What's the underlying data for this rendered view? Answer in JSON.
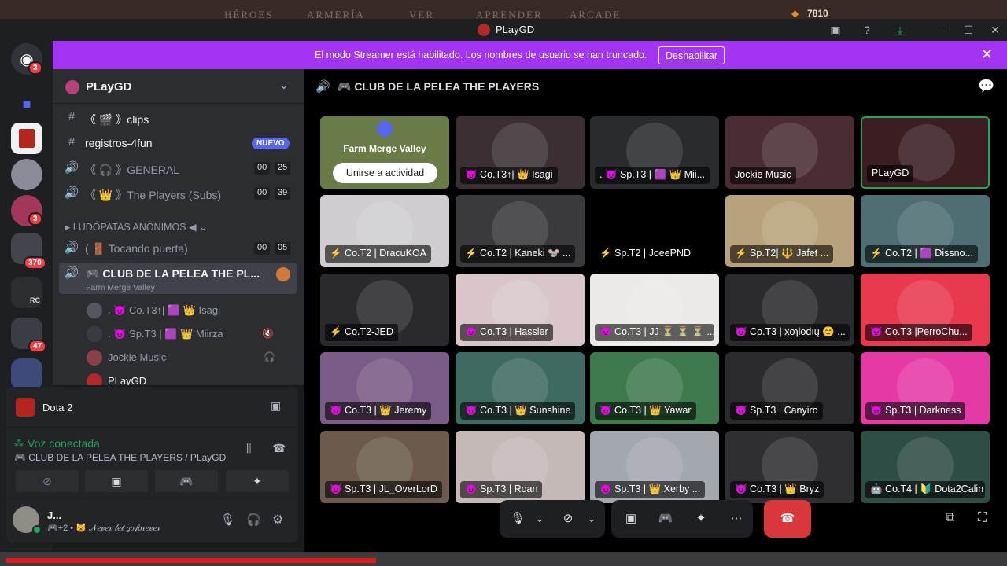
{
  "game_bar": {
    "tabs": [
      "HÉROES",
      "ARMERÍA",
      "VER",
      "APRENDER",
      "ARCADE"
    ],
    "shards": "7810"
  },
  "window": {
    "title": "PLayGD"
  },
  "banner": {
    "message": "El modo Streamer está habilitado. Los nombres de usuario se han truncado.",
    "button": "Deshabilitar"
  },
  "rail": {
    "badges": [
      "3",
      "3",
      "370",
      "47"
    ],
    "rc_label": "RC"
  },
  "server": {
    "name": "PLayGD"
  },
  "channels": [
    {
      "label": "《 🎬 》clips",
      "type": "text"
    },
    {
      "label": "registros-4fun",
      "type": "text",
      "badge": "NUEVO"
    },
    {
      "label": "《 🎧 》GENERAL",
      "type": "voice",
      "count_a": "00",
      "count_b": "25"
    },
    {
      "label": "《 👑 》The Players (Subs)",
      "type": "voice",
      "count_a": "00",
      "count_b": "39"
    }
  ],
  "category": {
    "label": "LUDÓPATAS ANÓNIMOS ◀"
  },
  "channels2": [
    {
      "label": "( 🚪 Tocando puerta)",
      "count_a": "00",
      "count_b": "05"
    },
    {
      "label": "🎮 CLUB DE LA PELEA THE PL...",
      "sub": "Farm Merge Valley"
    }
  ],
  "voice_users": [
    {
      "label": ". 😈 Co.T3↑| 🟪 👑 Isagi"
    },
    {
      "label": ". 😈 Sp.T3 | 🟪 👑 Miirza"
    },
    {
      "label": "Jockie Music"
    },
    {
      "label": "PLayGD"
    }
  ],
  "activity": {
    "name": "Dota 2"
  },
  "voice_status": {
    "title": "Voz conectada",
    "channel": "🎮 CLUB DE LA PELEA THE PLAYERS / PLayGD"
  },
  "user_panel": {
    "name": "J...",
    "status": "🎮+2 • 🐱 𝒩𝑒𝓋𝑒𝓇 𝓁𝑒𝓉 𝑔𝑜𝒻𝑜𝓇𝑒𝓋𝑒𝓇"
  },
  "stage": {
    "title": "🎮 CLUB DE LA PELEA THE PLAYERS"
  },
  "activity_tile": {
    "title": "Farm Merge Valley",
    "button": "Unirse a actividad"
  },
  "tiles": [
    {
      "label": "😈 Co.T3↑| 👑 Isagi",
      "bg": "#3a3033"
    },
    {
      "label": ". 😈 Sp.T3 | 🟪 👑 Mii...",
      "bg": "#2a2b2e"
    },
    {
      "label": "Jockie Music",
      "bg": "#4a2c33"
    },
    {
      "label": "PLayGD",
      "bg": "#3b1d22"
    },
    {
      "label": "⚡ Co.T2 | DracuKOA",
      "bg": "#cfcdd0"
    },
    {
      "label": "⚡ Co.T2 | Kaneki 🐭 ...",
      "bg": "#3a3a3d"
    },
    {
      "label": "⚡ Sp.T2 | JoeePND",
      "bg": "#000000"
    },
    {
      "label": "⚡ Sp.T2| 🔱 Jafet ...",
      "bg": "#b8a27a"
    },
    {
      "label": "⚡ Co.T2 | 🟪 Dissno...",
      "bg": "#4d6f73"
    },
    {
      "label": "⚡ Co.T2-JED",
      "bg": "#2a2a2d"
    },
    {
      "label": "😈 Co.T3 | Hassler",
      "bg": "#d8c6c8"
    },
    {
      "label": "😈 Co.T3 | JJ ⏳ ⏳ ⏳ ...",
      "bg": "#eceae6"
    },
    {
      "label": "😈 Co.T3 | xoɿlodıų 😊 ...",
      "bg": "#2b2b2e"
    },
    {
      "label": "😈 Co.T3 |PerroChu...",
      "bg": "#e8394f"
    },
    {
      "label": "😈 Co.T3 | 👑 Jeremy",
      "bg": "#7a5a86"
    },
    {
      "label": "😈 Co.T3 | 👑 Sunshine",
      "bg": "#3f6a62"
    },
    {
      "label": "😈 Co.T3 | 👑 Yawar",
      "bg": "#3f7a4f"
    },
    {
      "label": "😈 Sp.T3 | Canyiro",
      "bg": "#2b2b2e"
    },
    {
      "label": "😈 Sp.T3 | Darkness",
      "bg": "#e53aa6"
    },
    {
      "label": "😈 Sp.T3 | JL_OverLorD",
      "bg": "#6b5a4d"
    },
    {
      "label": "😈 Sp.T3 | Roan",
      "bg": "#c5b9b8"
    },
    {
      "label": "😈 Sp.T3 | 👑 Xerby ...",
      "bg": "#a3a7ae"
    },
    {
      "label": "😈 Co.T3 | 👑 Bryz",
      "bg": "#2f2f33"
    },
    {
      "label": "🤖 Co.T4 | 🔰 Dota2Calin",
      "bg": "#2e4d45"
    }
  ]
}
